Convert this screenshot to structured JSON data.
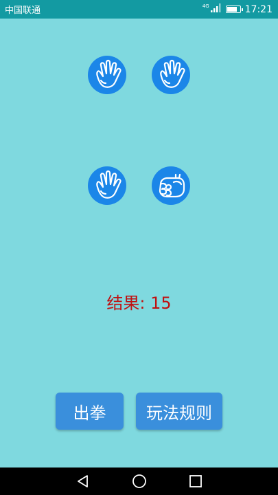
{
  "status_bar": {
    "carrier": "中国联通",
    "network_type": "4G",
    "battery_level": 0.8,
    "time": "17:21"
  },
  "hands": [
    {
      "row": 1,
      "col": 1,
      "gesture": "paper",
      "icon": "open-hand-icon"
    },
    {
      "row": 1,
      "col": 2,
      "gesture": "paper",
      "icon": "open-hand-icon"
    },
    {
      "row": 2,
      "col": 1,
      "gesture": "paper",
      "icon": "open-hand-icon"
    },
    {
      "row": 2,
      "col": 2,
      "gesture": "rock",
      "icon": "fist-icon"
    }
  ],
  "result": {
    "label": "结果: 15"
  },
  "buttons": {
    "play": "出拳",
    "rules": "玩法规则"
  },
  "colors": {
    "status_bar": "#139aa2",
    "background": "#7fd9df",
    "hand_circle": "#1b86e8",
    "result_text": "#c01010",
    "button": "#3a8fdc"
  },
  "nav": {
    "back_icon": "back-triangle-icon",
    "home_icon": "home-circle-icon",
    "recents_icon": "recents-square-icon"
  }
}
